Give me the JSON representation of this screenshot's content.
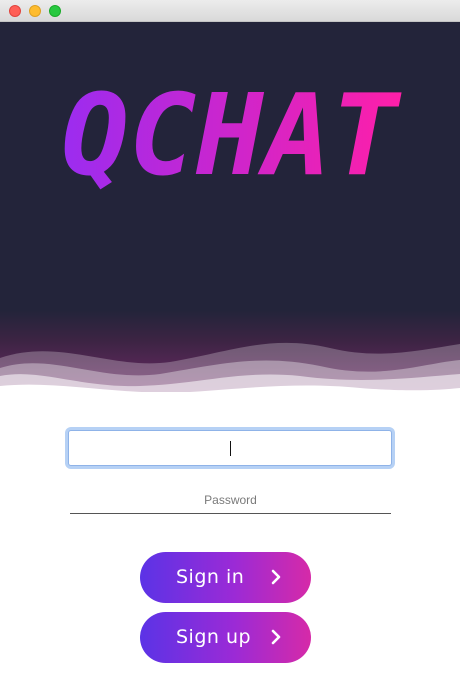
{
  "app": {
    "logo_text": "QCHAT",
    "brand_gradient": [
      "#9b2cf0",
      "#ff1fa8"
    ]
  },
  "titlebar": {
    "buttons": [
      "close",
      "minimize",
      "zoom"
    ]
  },
  "login": {
    "username": {
      "value": "",
      "placeholder": ""
    },
    "password": {
      "value": "",
      "placeholder": "Password"
    }
  },
  "buttons": {
    "sign_in_label": "Sign in",
    "sign_up_label": "Sign up",
    "gradient": [
      "#5b33e6",
      "#d62aa8"
    ]
  },
  "icons": {
    "button_arrow": "chevron-right-icon"
  }
}
